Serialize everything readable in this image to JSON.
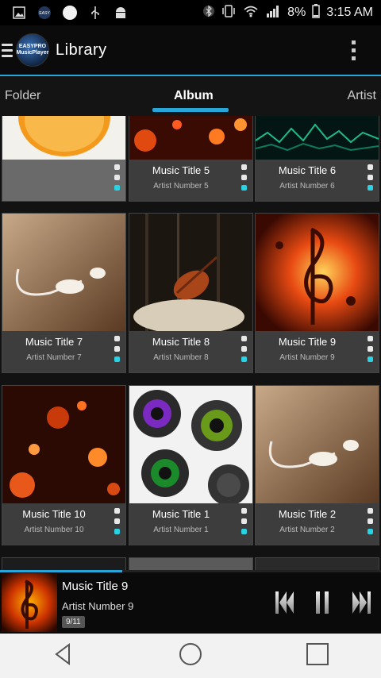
{
  "status_bar": {
    "battery": "8%",
    "time": "3:15 AM",
    "icons_left": [
      "image-icon",
      "app-icon",
      "circle-icon",
      "usb-icon",
      "android-icon"
    ],
    "icons_right": [
      "bluetooth-icon",
      "vibrate-icon",
      "wifi-icon",
      "signal-icon",
      "battery-icon"
    ]
  },
  "app_bar": {
    "title": "Library",
    "logo_text": "EASYPRO MusicPlayer",
    "menu_icon": "hamburger-icon",
    "overflow_icon": "more-vert-icon"
  },
  "tabs": [
    {
      "label": "Folder",
      "active": false
    },
    {
      "label": "Album",
      "active": true
    },
    {
      "label": "Artist",
      "active": false
    }
  ],
  "grid": {
    "items": [
      {
        "title": "",
        "artist": "",
        "art": "orange"
      },
      {
        "title": "Music Title 5",
        "artist": "Artist Number 5",
        "art": "hearts"
      },
      {
        "title": "Music Title 6",
        "artist": "Artist Number 6",
        "art": "waves"
      },
      {
        "title": "Music Title 7",
        "artist": "Artist Number 7",
        "art": "earphones"
      },
      {
        "title": "Music Title 8",
        "artist": "Artist Number 8",
        "art": "violin"
      },
      {
        "title": "Music Title 9",
        "artist": "Artist Number 9",
        "art": "notes"
      },
      {
        "title": "Music Title 10",
        "artist": "Artist Number 10",
        "art": "hearts2"
      },
      {
        "title": "Music Title 1",
        "artist": "Artist Number 1",
        "art": "lenses"
      },
      {
        "title": "Music Title 2",
        "artist": "Artist Number 2",
        "art": "earphones2"
      }
    ]
  },
  "mini_player": {
    "title": "Music Title 9",
    "artist": "Artist Number 9",
    "count": "9/11",
    "progress": 0.32,
    "controls": [
      "previous-icon",
      "pause-icon",
      "next-icon"
    ]
  },
  "nav_bar": [
    "back-icon",
    "home-icon",
    "recents-icon"
  ],
  "colors": {
    "accent": "#29a6d9",
    "dot_accent": "#29d3e4"
  }
}
